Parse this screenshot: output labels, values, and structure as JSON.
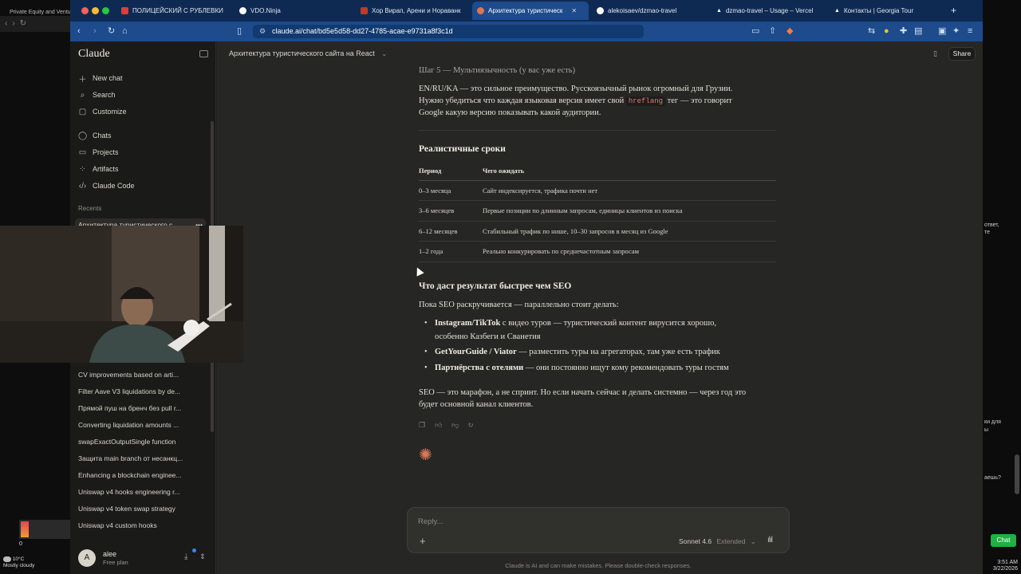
{
  "left_window": {
    "tab_title": "Private Equity and Ventur"
  },
  "browser": {
    "tabs": [
      {
        "label": "ПОЛИЦЕЙСКИЙ С РУБЛЕВКИ",
        "color": "#e53935"
      },
      {
        "label": "VDO.Ninja",
        "color": "#ffffff"
      },
      {
        "label": "Хор Вирап, Арени и Нораванк",
        "color": "#c0392b"
      },
      {
        "label": "Архитектура туристическ",
        "color": "#d97757"
      },
      {
        "label": "alekoisaev/dzmao-travel",
        "color": "#ffffff"
      },
      {
        "label": "dzmao-travel – Usage – Vercel",
        "color": "#ffffff"
      },
      {
        "label": "Контакты | Georgia Tour",
        "color": "#ffffff"
      }
    ],
    "url": "claude.ai/chat/bd5e5d58-dd27-4785-acae-e9731a8f3c1d"
  },
  "sidebar": {
    "logo": "Claude",
    "nav": [
      {
        "label": "New chat",
        "icon": "plus-icon"
      },
      {
        "label": "Search",
        "icon": "search-icon"
      },
      {
        "label": "Customize",
        "icon": "customize-icon"
      },
      {
        "label": "Chats",
        "icon": "chat-icon"
      },
      {
        "label": "Projects",
        "icon": "folder-icon"
      },
      {
        "label": "Artifacts",
        "icon": "artifacts-icon"
      },
      {
        "label": "Claude Code",
        "icon": "code-icon"
      }
    ],
    "recents_header": "Recents",
    "recent_active": "Архитектура туристического с",
    "recents": [
      "CV improvements based on arti...",
      "Filter Aave V3 liquidations by de...",
      "Прямой пуш на бренч без pull r...",
      "Converting liquidation amounts ...",
      "swapExactOutputSingle function",
      "Защита main branch от несанкц...",
      "Enhancing a blockchain enginee...",
      "Uniswap v4 hooks engineering r...",
      "Uniswap v4 token swap strategy",
      "Uniswap v4 custom hooks"
    ],
    "user": {
      "initial": "A",
      "name": "alee",
      "plan": "Free plan"
    }
  },
  "main": {
    "title": "Архитектура туристического сайта на React",
    "share": "Share",
    "step5_heading": "Шаг 5 — Мультиязычность (у вас уже есть)",
    "step5_p1": "EN/RU/KA — это сильное преимущество. Русскоязычный рынок огромный для Грузии.",
    "step5_p2a": "Нужно убедиться что каждая языковая версия имеет свой",
    "step5_code": "hreflang",
    "step5_p2b": "тег — это говорит",
    "step5_p3": "Google какую версию показывать какой аудитории.",
    "timeline_heading": "Реалистичные сроки",
    "table": {
      "headers": [
        "Период",
        "Чего ожидать"
      ],
      "rows": [
        [
          "0–3 месяца",
          "Сайт индексируется, трафика почти нет"
        ],
        [
          "3–6 месяцев",
          "Первые позиции по длинным запросам, единицы клиентов из поиска"
        ],
        [
          "6–12 месяцев",
          "Стабильный трафик по нише, 10–30 запросов в месяц из Google"
        ],
        [
          "1–2 года",
          "Реально конкурировать по среднечастотным запросам"
        ]
      ]
    },
    "faster_heading": "Что даст результат быстрее чем SEO",
    "faster_intro": "Пока SEO раскручивается — параллельно стоит делать:",
    "bullets": [
      {
        "bold": "Instagram/TikTok",
        "text": " с видео туров — туристический контент вирусится хорошо,",
        "text2": "особенно Казбеги и Сванетия"
      },
      {
        "bold": "GetYourGuide / Viator",
        "text": " — разместить туры на агрегаторах, там уже есть трафик"
      },
      {
        "bold": "Партнёрства с отелями",
        "text": " — они постоянно ищут кому рекомендовать туры гостям"
      }
    ],
    "closing_1": "SEO — это марафон, а не спринт. Но если начать сейчас и делать системно — через год это",
    "closing_2": "будет основной канал клиентов.",
    "composer": {
      "placeholder": "Reply...",
      "model": "Sonnet 4.6",
      "mode": "Extended"
    },
    "disclaimer": "Claude is AI and can make mistakes. Please double-check responses."
  },
  "right_window": {
    "fragments": [
      "ответ,",
      "те",
      "ки для",
      "ы",
      "аешь?"
    ],
    "chat_button": "Chat",
    "time": "3:51 AM",
    "date": "3/22/2026"
  },
  "taskbar": {
    "weather_temp": "10°C",
    "weather_desc": "Mostly cloudy",
    "counter": "0"
  }
}
